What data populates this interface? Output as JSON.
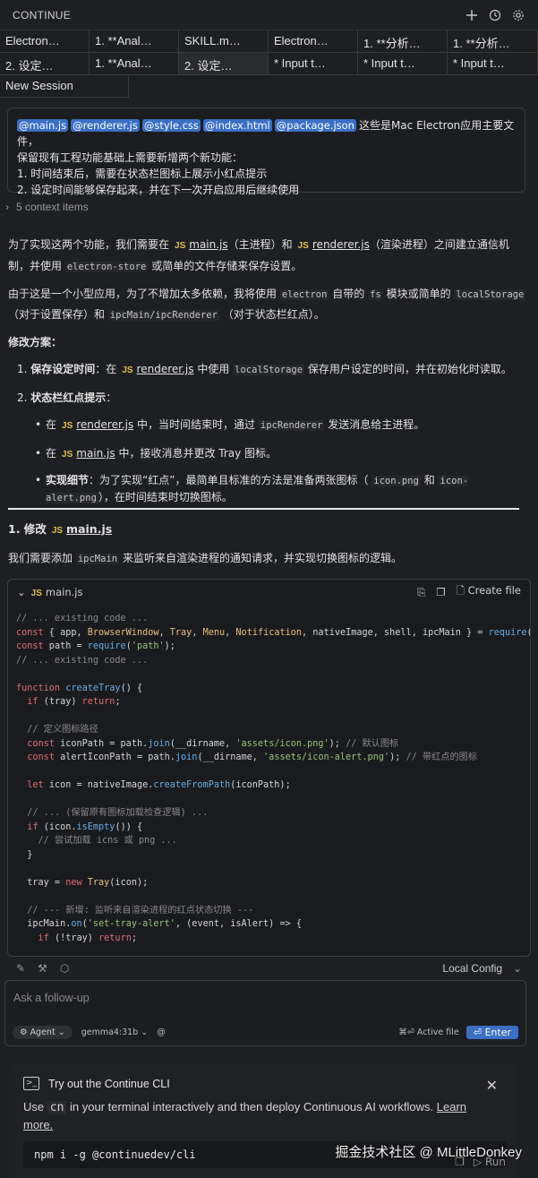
{
  "header": {
    "title": "CONTINUE",
    "icons": [
      "plus-icon",
      "history-icon",
      "gear-icon"
    ]
  },
  "tabs": {
    "row1": [
      "Electron…",
      "1. **Anal…",
      "SKILL.m…",
      "Electron…",
      "1. **分析…",
      "1. **分析…"
    ],
    "row2": [
      "2. 设定…",
      "1. **Anal…",
      "2. 设定…",
      "* Input t…",
      "* Input t…",
      "* Input t…"
    ],
    "row3": [
      "New Session"
    ]
  },
  "user_message": {
    "mentions": [
      "@main.js",
      "@renderer.js",
      "@style.css",
      "@index.html",
      "@package.json"
    ],
    "line1_suffix": "这些是Mac Electron应用主要文件，",
    "line2": "保留现有工程功能基础上需要新增两个新功能：",
    "line3": "1. 时间结束后，需要在状态栏图标上展示小红点提示",
    "line4": "2. 设定时间能够保存起来，并在下一次开启应用后继续使用"
  },
  "context": {
    "label": "5 context items"
  },
  "assistant": {
    "p1": {
      "a": "为了实现这两个功能，我们需要在",
      "file1": "main.js",
      "b": "（主进程）和",
      "file2": "renderer.js",
      "c": "（渲染进程）之间建立通信机制，并使用",
      "code1": "electron-store",
      "d": "或简单的文件存储来保存设置。"
    },
    "p2": {
      "a": "由于这是一个小型应用，为了不增加太多依赖，我将使用",
      "code1": "electron",
      "b": "自带的",
      "code2": "fs",
      "c": "模块或简单的",
      "code3": "localStorage",
      "d": "（对于设置保存）和",
      "code4": "ipcMain/ipcRenderer",
      "e": "（对于状态栏红点）。"
    },
    "plan_heading": "修改方案：",
    "item1": {
      "num": "1.",
      "title": "保存设定时间",
      "a": "：在",
      "file": "renderer.js",
      "b": "中使用",
      "code": "localStorage",
      "c": "保存用户设定的时间，并在初始化时读取。"
    },
    "item2": {
      "num": "2.",
      "title": "状态栏红点提示",
      "colon": "："
    },
    "bullet1": {
      "a": "在",
      "file": "renderer.js",
      "b": "中，当时间结束时，通过",
      "code": "ipcRenderer",
      "c": "发送消息给主进程。"
    },
    "bullet2": {
      "a": "在",
      "file": "main.js",
      "b": "中，接收消息并更改 Tray 图标。"
    },
    "bullet3": {
      "title": "实现细节",
      "a": "：为了实现“红点”，最简单且标准的方法是准备两张图标（",
      "code1": "icon.png",
      "b": "和",
      "code2": "icon-alert.png",
      "c": "），在时间结束时切换图标。"
    },
    "modify_heading_prefix": "1. 修改",
    "modify_file": "main.js",
    "modify_desc_a": "我们需要添加",
    "modify_desc_code": "ipcMain",
    "modify_desc_b": "来监听来自渲染进程的通知请求，并实现切换图标的逻辑。"
  },
  "codeblock": {
    "filename": "main.js",
    "badge": "JS",
    "create_file_label": "Create file"
  },
  "js_badge": "JS",
  "toolbar": {
    "local_config": "Local Config"
  },
  "input": {
    "placeholder": "Ask a follow-up",
    "agent_label": "Agent",
    "model": "gemma4:31b",
    "at_symbol": "@",
    "active_file": "⌘⏎ Active file",
    "enter_label": "⏎ Enter"
  },
  "cli": {
    "title": "Try out the Continue CLI",
    "text_a": "Use",
    "text_code": "cn",
    "text_b": "in your terminal interactively and then deploy Continuous AI workflows.",
    "link": "Learn more.",
    "command": "npm i -g @continuedev/cli",
    "run": "Run"
  },
  "watermark": "掘金技术社区 @ MLittleDonkey"
}
